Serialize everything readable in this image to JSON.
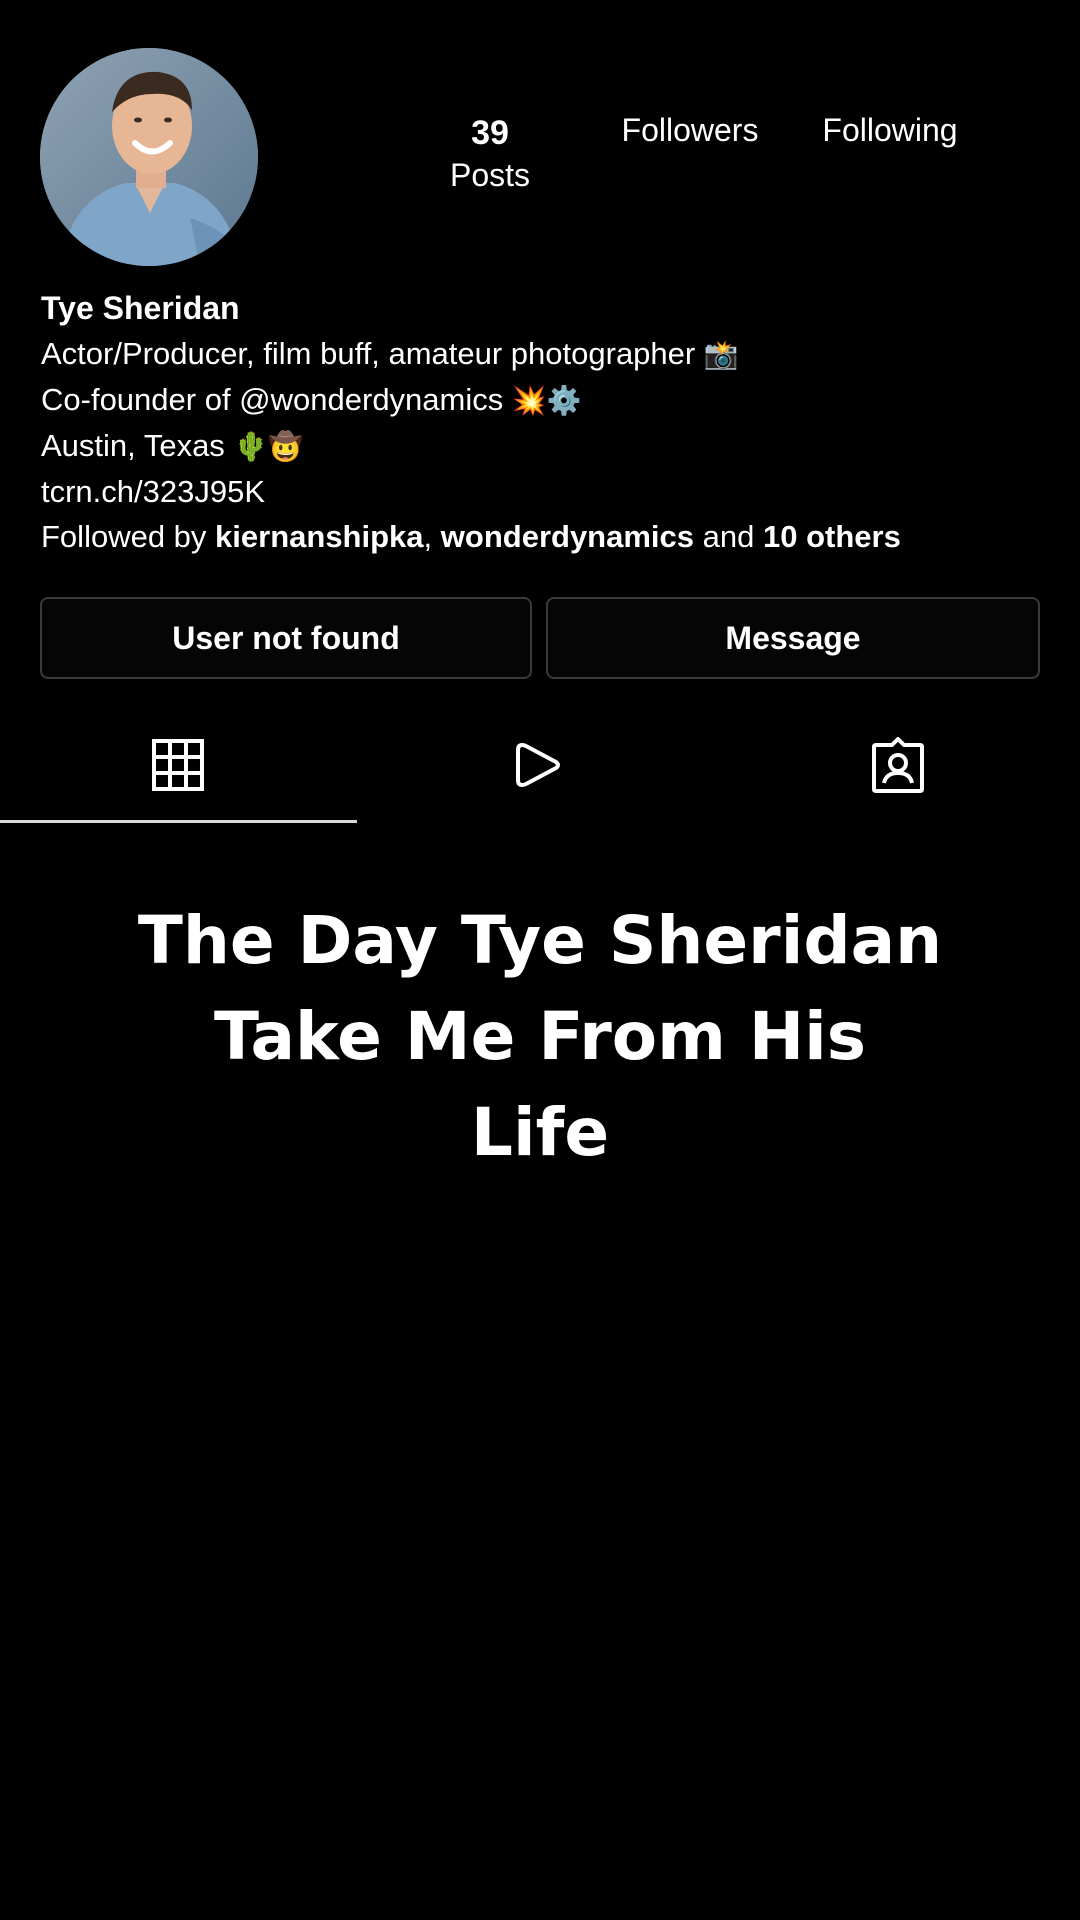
{
  "profile": {
    "name": "Tye Sheridan",
    "avatar_icon": "profile-photo"
  },
  "stats": {
    "posts_count": "39",
    "posts_label": "Posts",
    "followers_label": "Followers",
    "following_label": "Following"
  },
  "bio": {
    "line1": "Actor/Producer, film buff, amateur photographer",
    "line1_emoji": "📸",
    "line2": "Co-founder of @wonderdynamics",
    "line2_emoji": "💥⚙️",
    "line3": "Austin, Texas",
    "line3_emoji": "🌵🤠",
    "link": "tcrn.ch/323J95K",
    "followed_by_prefix": "Followed by",
    "followed_by_user1": "kiernanshipka",
    "followed_by_sep": ",",
    "followed_by_user2": "wonderdynamics",
    "followed_by_and": "and",
    "followed_by_others": "10 others"
  },
  "buttons": {
    "left_label": "User not found",
    "right_label": "Message"
  },
  "tabs": [
    {
      "icon": "grid-icon"
    },
    {
      "icon": "reels-icon"
    },
    {
      "icon": "tagged-icon"
    }
  ],
  "overlay": {
    "line1": "The Day Tye Sheridan",
    "line2": "Take Me From His",
    "line3": "Life"
  },
  "colors": {
    "background": "#000000",
    "text": "#ffffff",
    "button_border": "#3a3a3a"
  }
}
